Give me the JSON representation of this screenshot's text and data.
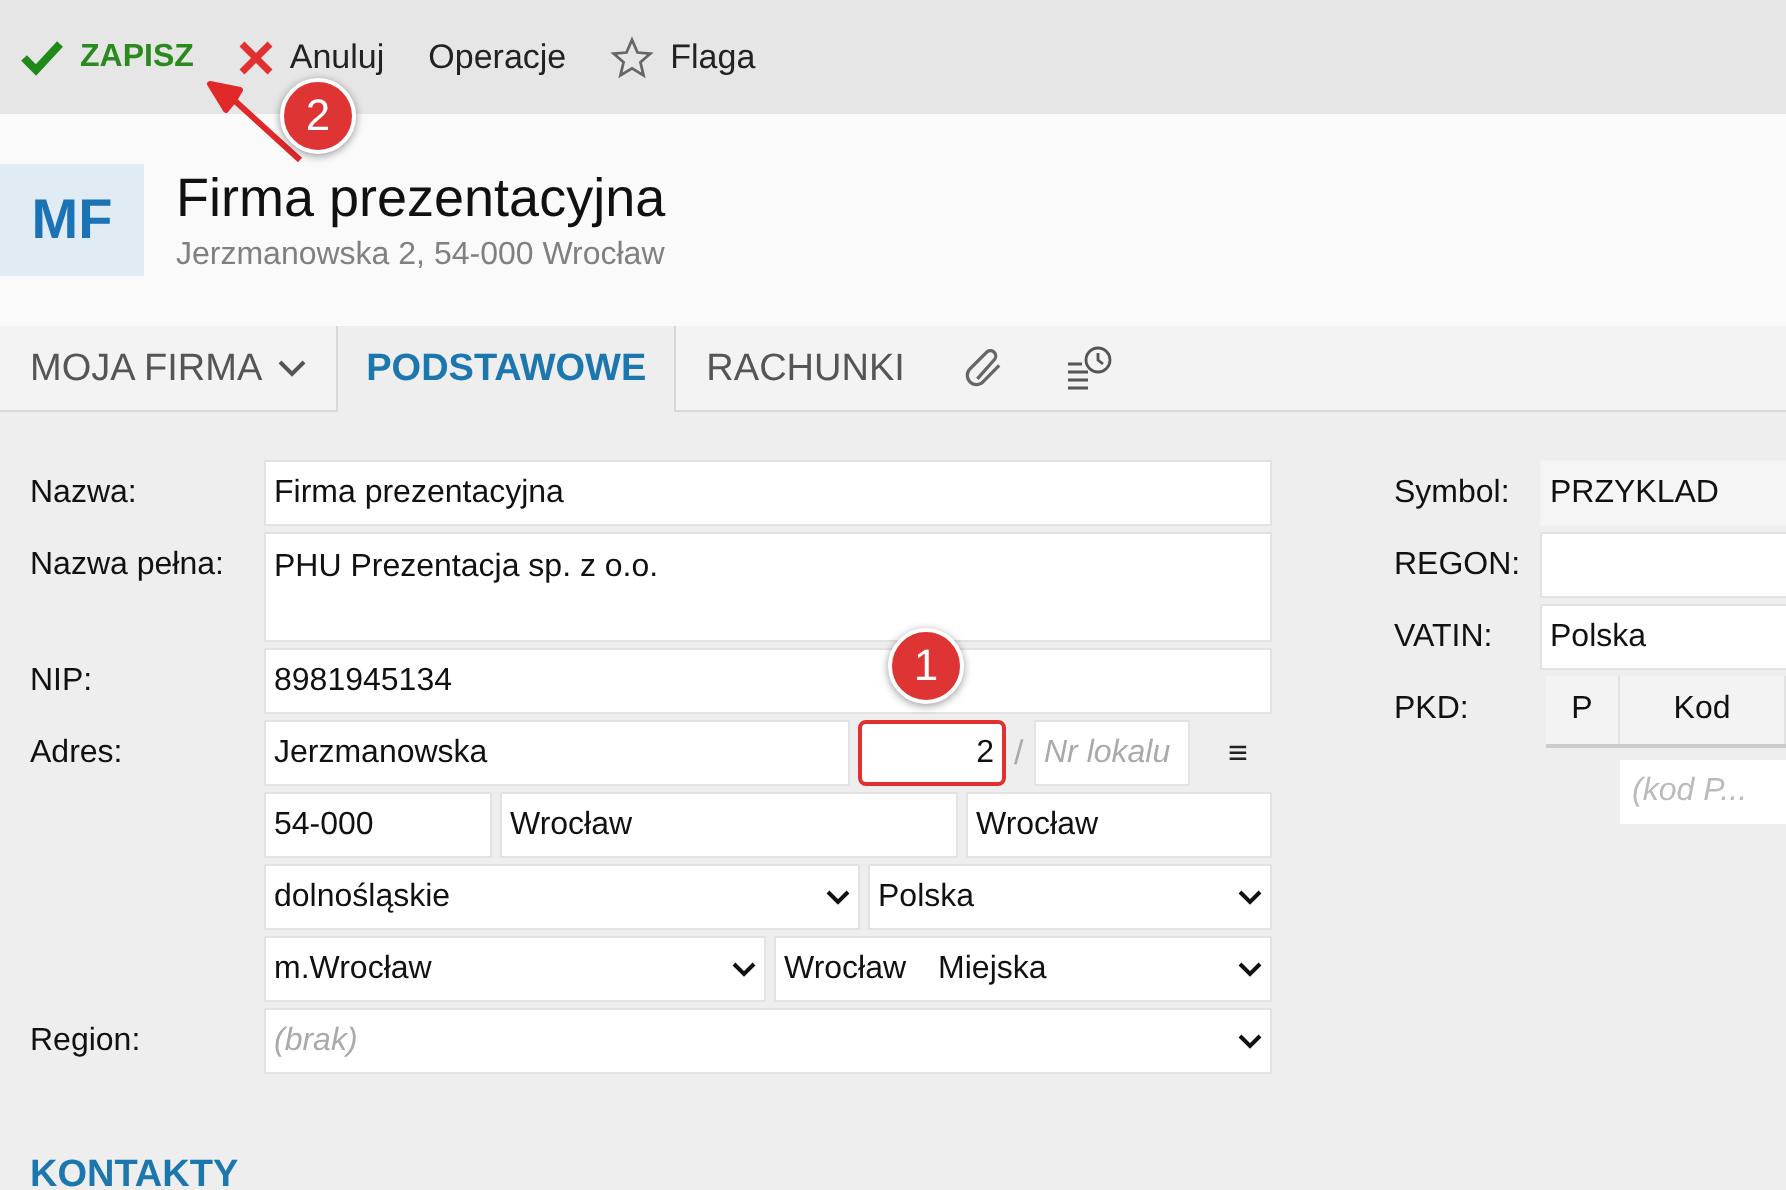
{
  "toolbar": [
    {
      "kind": "save",
      "label": "ZAPISZ"
    },
    {
      "kind": "cancel",
      "label": "Anuluj"
    },
    {
      "kind": "plain",
      "label": "Operacje"
    },
    {
      "kind": "flag",
      "label": "Flaga"
    }
  ],
  "header": {
    "initials": "MF",
    "title": "Firma prezentacyjna",
    "subtitle": "Jerzmanowska 2, 54-000 Wrocław"
  },
  "tabs": [
    {
      "kind": "dropdown",
      "label": "MOJA FIRMA",
      "selected": false
    },
    {
      "kind": "text",
      "label": "PODSTAWOWE",
      "selected": true
    },
    {
      "kind": "text",
      "label": "RACHUNKI",
      "selected": false
    },
    {
      "kind": "attachment",
      "selected": false
    },
    {
      "kind": "history",
      "selected": false
    }
  ],
  "form": [
    {
      "label": "Nazwa:",
      "fields": [
        {
          "kind": "full",
          "value": "Firma prezentacyjna",
          "highlighted": false
        }
      ]
    },
    {
      "label": "Nazwa pełna:",
      "fields": [
        {
          "kind": "multiline",
          "value": "PHU Prezentacja sp. z o.o.",
          "highlighted": false
        }
      ]
    },
    {
      "label": "NIP:",
      "fields": [
        {
          "kind": "full",
          "value": "8981945134",
          "highlighted": false
        }
      ]
    },
    {
      "label": "Adres:",
      "fields": [
        {
          "kind": "street",
          "value": "Jerzmanowska",
          "highlighted": false
        },
        {
          "kind": "number",
          "value": "2",
          "highlighted": true
        },
        {
          "kind": "separator",
          "value": "/",
          "highlighted": false
        },
        {
          "kind": "unit",
          "placeholder": "Nr lokalu",
          "highlighted": false
        },
        {
          "kind": "menu",
          "value": "≡",
          "highlighted": false
        }
      ]
    },
    {
      "fields": [
        {
          "kind": "postal",
          "value": "54-000",
          "highlighted": false
        },
        {
          "kind": "city",
          "value": "Wrocław",
          "highlighted": false
        },
        {
          "kind": "postcity",
          "value": "Wrocław",
          "highlighted": false
        }
      ]
    },
    {
      "fields": [
        {
          "kind": "province",
          "value": "dolnośląskie",
          "highlighted": false
        },
        {
          "kind": "country",
          "value": "Polska",
          "highlighted": false
        }
      ]
    },
    {
      "fields": [
        {
          "kind": "county",
          "value": "m.Wrocław",
          "highlighted": false
        },
        {
          "kind": "commune",
          "value": "Wrocław",
          "extra": "Miejska",
          "highlighted": false
        }
      ]
    },
    {
      "label": "Region:",
      "fields": [
        {
          "kind": "region",
          "placeholder": "(brak)",
          "highlighted": false
        }
      ]
    }
  ],
  "side": [
    {
      "kind": "field",
      "label": "Symbol:",
      "value": "PRZYKLAD",
      "readonly": true
    },
    {
      "kind": "field",
      "label": "REGON:",
      "readonly": false
    },
    {
      "kind": "field",
      "label": "VATIN:",
      "value": "Polska",
      "readonly": false
    },
    {
      "kind": "table",
      "label": "PKD:",
      "columns": [
        "P",
        "Kod"
      ],
      "placeholder": "(kod P..."
    }
  ],
  "section_title": "KONTAKTY",
  "annotations": [
    {
      "number": "1"
    },
    {
      "number": "2"
    }
  ]
}
